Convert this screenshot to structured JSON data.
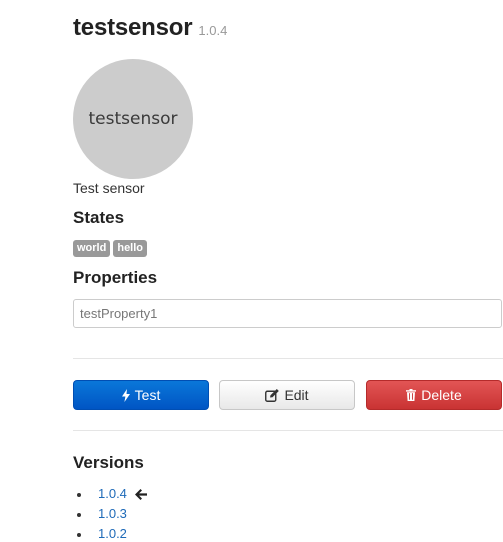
{
  "header": {
    "title": "testsensor",
    "version": "1.0.4"
  },
  "avatar": {
    "text": "testsensor"
  },
  "description": "Test sensor",
  "states": {
    "heading": "States",
    "items": [
      "world",
      "hello"
    ]
  },
  "properties": {
    "heading": "Properties",
    "items": [
      {
        "value": "testProperty1"
      }
    ]
  },
  "actions": {
    "test_label": "Test",
    "edit_label": "Edit",
    "delete_label": "Delete"
  },
  "versions": {
    "heading": "Versions",
    "items": [
      {
        "label": "1.0.4",
        "current": true
      },
      {
        "label": "1.0.3"
      },
      {
        "label": "1.0.2"
      }
    ]
  },
  "colors": {
    "primary": "#0066cc",
    "danger": "#d84343",
    "link": "#1e6ab8",
    "label_bg": "#999999",
    "avatar_bg": "#cccccc"
  },
  "icons": {
    "test": "bolt-icon",
    "edit": "edit-icon",
    "delete": "trash-icon",
    "current_version": "arrow-left-icon"
  }
}
